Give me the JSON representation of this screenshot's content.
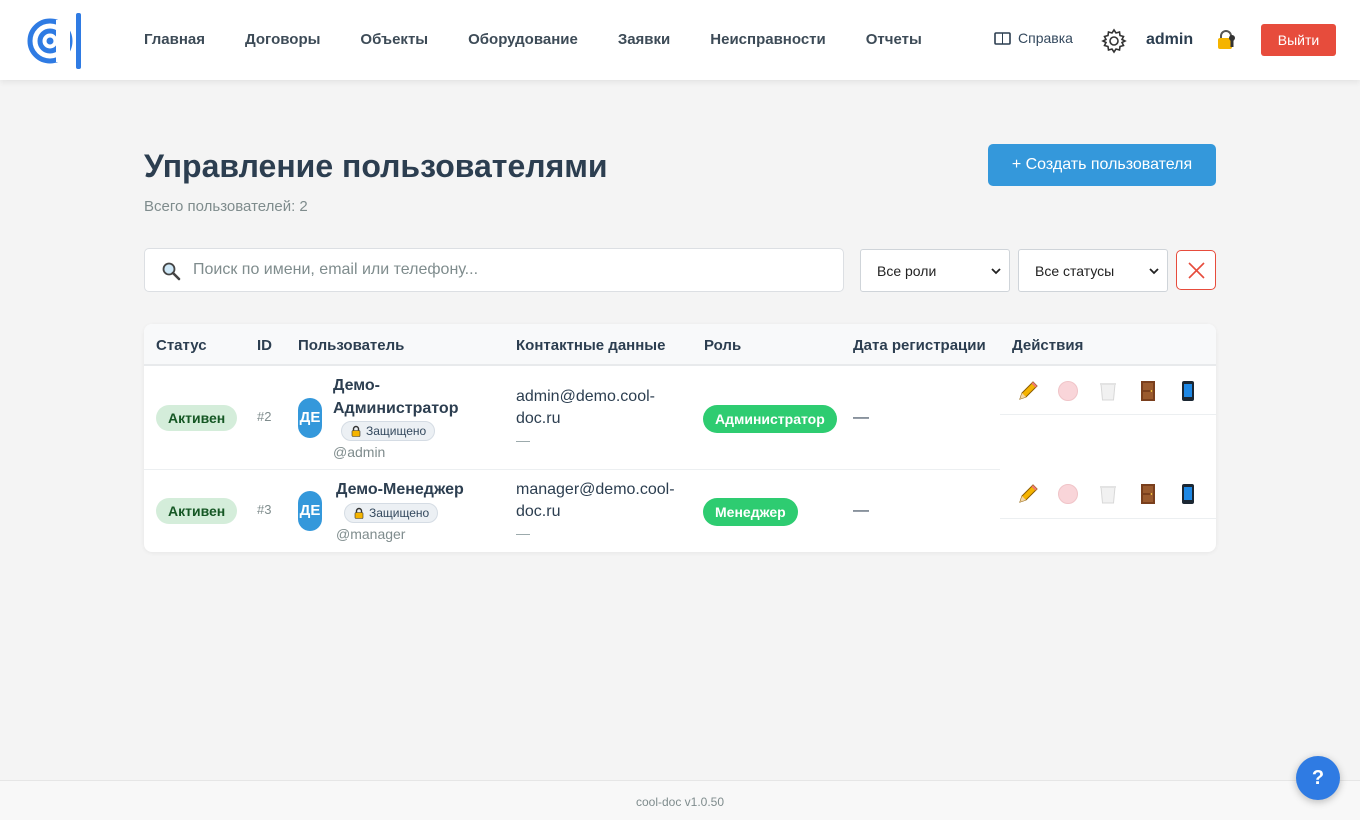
{
  "header": {
    "nav": [
      "Главная",
      "Договоры",
      "Объекты",
      "Оборудование",
      "Заявки",
      "Неисправности",
      "Отчеты"
    ],
    "help_label": "Справка",
    "username": "admin",
    "logout_label": "Выйти"
  },
  "page": {
    "title": "Управление пользователями",
    "subtitle": "Всего пользователей: 2",
    "create_label": "+ Создать пользователя"
  },
  "filters": {
    "search_placeholder": "Поиск по имени, email или телефону...",
    "search_value": "",
    "role_selected": "Все роли",
    "status_selected": "Все статусы"
  },
  "table": {
    "columns": [
      "Статус",
      "ID",
      "Пользователь",
      "Контактные данные",
      "Роль",
      "Дата регистрации",
      "Действия"
    ],
    "rows": [
      {
        "status": "Активен",
        "id": "#2",
        "avatar": "ДЕ",
        "name_line1": "Демо-",
        "name_line2": "Администратор",
        "protected_label": "Защищено",
        "login": "@admin",
        "email_line1": "admin@demo.cool-",
        "email_line2": "doc.ru",
        "phone": "—",
        "role": "Администратор",
        "date": "—"
      },
      {
        "status": "Активен",
        "id": "#3",
        "avatar": "ДЕ",
        "name_line1": "Демо-Менеджер",
        "protected_label": "Защищено",
        "login": "@manager",
        "email_line1": "manager@demo.cool-",
        "email_line2": "doc.ru",
        "phone": "—",
        "role": "Менеджер",
        "date": "—"
      }
    ],
    "row_actions": [
      "pencil-icon",
      "deactivate-icon",
      "trash-icon",
      "door-icon",
      "phone-icon"
    ]
  },
  "footer": {
    "version": "cool-doc v1.0.50",
    "help_fab": "?"
  },
  "colors": {
    "primary": "#3498db",
    "danger": "#e74c3c",
    "success": "#2ecc71",
    "status_bg": "#d4edda",
    "status_fg": "#155724"
  }
}
